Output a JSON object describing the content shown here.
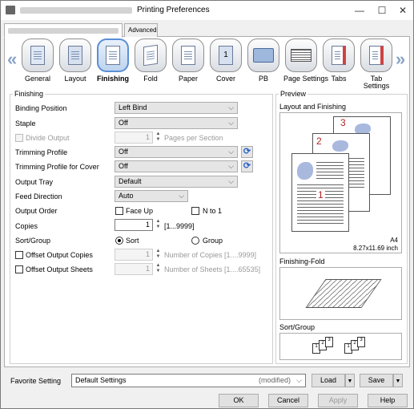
{
  "window": {
    "title": "Printing Preferences",
    "minimize": "—",
    "maximize": "☐",
    "close": "✕"
  },
  "top_tabs": {
    "advanced": "Advanced"
  },
  "nav": {
    "left_arrow": "«",
    "right_arrow": "»"
  },
  "feature_tabs": [
    {
      "label": "General",
      "icon": "general-icon"
    },
    {
      "label": "Layout",
      "icon": "layout-icon"
    },
    {
      "label": "Finishing",
      "icon": "finishing-icon",
      "selected": true
    },
    {
      "label": "Fold",
      "icon": "fold-icon"
    },
    {
      "label": "Paper",
      "icon": "paper-icon"
    },
    {
      "label": "Cover",
      "icon": "cover-icon",
      "glyph": "1"
    },
    {
      "label": "PB",
      "icon": "pb-icon"
    },
    {
      "label": "Page Settings",
      "icon": "page-settings-icon"
    },
    {
      "label": "Tabs",
      "icon": "tabs-icon"
    },
    {
      "label": "Tab\nSettings",
      "icon": "tab-settings-icon"
    }
  ],
  "finishing": {
    "group_title": "Finishing",
    "binding_position": {
      "label": "Binding Position",
      "value": "Left Bind"
    },
    "staple": {
      "label": "Staple",
      "value": "Off"
    },
    "divide_output": {
      "label": "Divide Output",
      "value": "1",
      "suffix": "Pages per Section"
    },
    "trimming_profile": {
      "label": "Trimming Profile",
      "value": "Off"
    },
    "trimming_profile_cover": {
      "label": "Trimming Profile for Cover",
      "value": "Off"
    },
    "output_tray": {
      "label": "Output Tray",
      "value": "Default"
    },
    "feed_direction": {
      "label": "Feed Direction",
      "value": "Auto"
    },
    "output_order": {
      "label": "Output Order",
      "face_up": "Face Up",
      "n_to_1": "N to 1"
    },
    "copies": {
      "label": "Copies",
      "value": "1",
      "range": "[1...9999]"
    },
    "sort_group": {
      "label": "Sort/Group",
      "sort": "Sort",
      "group": "Group",
      "selected": "Sort"
    },
    "offset_copies": {
      "label": "Offset Output Copies",
      "value": "1",
      "suffix": "Number of Copies [1....9999]"
    },
    "offset_sheets": {
      "label": "Offset Output Sheets",
      "value": "1",
      "suffix": "Number of Sheets [1....65535]"
    }
  },
  "preview": {
    "group_title": "Preview",
    "layout_title": "Layout and Finishing",
    "pages": [
      "1",
      "2",
      "3"
    ],
    "paper_size": "A4",
    "paper_dims": "8.27x11.69 inch",
    "fold_title": "Finishing-Fold",
    "sort_title": "Sort/Group",
    "sort_stack_a": [
      "1",
      "2",
      "3"
    ],
    "sort_stack_b": [
      "1",
      "2",
      "3"
    ]
  },
  "footer": {
    "favorite_label": "Favorite Setting",
    "favorite_value": "Default Settings",
    "favorite_modified": "(modified)",
    "load": "Load",
    "save": "Save"
  },
  "buttons": {
    "ok": "OK",
    "cancel": "Cancel",
    "apply": "Apply",
    "help": "Help"
  },
  "colors": {
    "accent": "#5b8fd4",
    "page_number": "#b22222"
  }
}
